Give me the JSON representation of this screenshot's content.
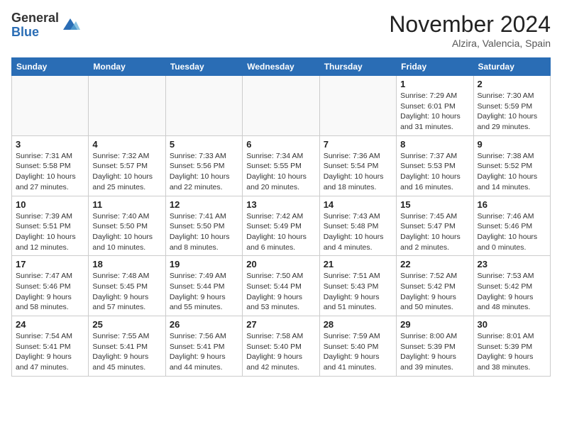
{
  "logo": {
    "general": "General",
    "blue": "Blue"
  },
  "header": {
    "month_year": "November 2024",
    "location": "Alzira, Valencia, Spain"
  },
  "weekdays": [
    "Sunday",
    "Monday",
    "Tuesday",
    "Wednesday",
    "Thursday",
    "Friday",
    "Saturday"
  ],
  "weeks": [
    [
      {
        "day": "",
        "info": ""
      },
      {
        "day": "",
        "info": ""
      },
      {
        "day": "",
        "info": ""
      },
      {
        "day": "",
        "info": ""
      },
      {
        "day": "",
        "info": ""
      },
      {
        "day": "1",
        "info": "Sunrise: 7:29 AM\nSunset: 6:01 PM\nDaylight: 10 hours\nand 31 minutes."
      },
      {
        "day": "2",
        "info": "Sunrise: 7:30 AM\nSunset: 5:59 PM\nDaylight: 10 hours\nand 29 minutes."
      }
    ],
    [
      {
        "day": "3",
        "info": "Sunrise: 7:31 AM\nSunset: 5:58 PM\nDaylight: 10 hours\nand 27 minutes."
      },
      {
        "day": "4",
        "info": "Sunrise: 7:32 AM\nSunset: 5:57 PM\nDaylight: 10 hours\nand 25 minutes."
      },
      {
        "day": "5",
        "info": "Sunrise: 7:33 AM\nSunset: 5:56 PM\nDaylight: 10 hours\nand 22 minutes."
      },
      {
        "day": "6",
        "info": "Sunrise: 7:34 AM\nSunset: 5:55 PM\nDaylight: 10 hours\nand 20 minutes."
      },
      {
        "day": "7",
        "info": "Sunrise: 7:36 AM\nSunset: 5:54 PM\nDaylight: 10 hours\nand 18 minutes."
      },
      {
        "day": "8",
        "info": "Sunrise: 7:37 AM\nSunset: 5:53 PM\nDaylight: 10 hours\nand 16 minutes."
      },
      {
        "day": "9",
        "info": "Sunrise: 7:38 AM\nSunset: 5:52 PM\nDaylight: 10 hours\nand 14 minutes."
      }
    ],
    [
      {
        "day": "10",
        "info": "Sunrise: 7:39 AM\nSunset: 5:51 PM\nDaylight: 10 hours\nand 12 minutes."
      },
      {
        "day": "11",
        "info": "Sunrise: 7:40 AM\nSunset: 5:50 PM\nDaylight: 10 hours\nand 10 minutes."
      },
      {
        "day": "12",
        "info": "Sunrise: 7:41 AM\nSunset: 5:50 PM\nDaylight: 10 hours\nand 8 minutes."
      },
      {
        "day": "13",
        "info": "Sunrise: 7:42 AM\nSunset: 5:49 PM\nDaylight: 10 hours\nand 6 minutes."
      },
      {
        "day": "14",
        "info": "Sunrise: 7:43 AM\nSunset: 5:48 PM\nDaylight: 10 hours\nand 4 minutes."
      },
      {
        "day": "15",
        "info": "Sunrise: 7:45 AM\nSunset: 5:47 PM\nDaylight: 10 hours\nand 2 minutes."
      },
      {
        "day": "16",
        "info": "Sunrise: 7:46 AM\nSunset: 5:46 PM\nDaylight: 10 hours\nand 0 minutes."
      }
    ],
    [
      {
        "day": "17",
        "info": "Sunrise: 7:47 AM\nSunset: 5:46 PM\nDaylight: 9 hours\nand 58 minutes."
      },
      {
        "day": "18",
        "info": "Sunrise: 7:48 AM\nSunset: 5:45 PM\nDaylight: 9 hours\nand 57 minutes."
      },
      {
        "day": "19",
        "info": "Sunrise: 7:49 AM\nSunset: 5:44 PM\nDaylight: 9 hours\nand 55 minutes."
      },
      {
        "day": "20",
        "info": "Sunrise: 7:50 AM\nSunset: 5:44 PM\nDaylight: 9 hours\nand 53 minutes."
      },
      {
        "day": "21",
        "info": "Sunrise: 7:51 AM\nSunset: 5:43 PM\nDaylight: 9 hours\nand 51 minutes."
      },
      {
        "day": "22",
        "info": "Sunrise: 7:52 AM\nSunset: 5:42 PM\nDaylight: 9 hours\nand 50 minutes."
      },
      {
        "day": "23",
        "info": "Sunrise: 7:53 AM\nSunset: 5:42 PM\nDaylight: 9 hours\nand 48 minutes."
      }
    ],
    [
      {
        "day": "24",
        "info": "Sunrise: 7:54 AM\nSunset: 5:41 PM\nDaylight: 9 hours\nand 47 minutes."
      },
      {
        "day": "25",
        "info": "Sunrise: 7:55 AM\nSunset: 5:41 PM\nDaylight: 9 hours\nand 45 minutes."
      },
      {
        "day": "26",
        "info": "Sunrise: 7:56 AM\nSunset: 5:41 PM\nDaylight: 9 hours\nand 44 minutes."
      },
      {
        "day": "27",
        "info": "Sunrise: 7:58 AM\nSunset: 5:40 PM\nDaylight: 9 hours\nand 42 minutes."
      },
      {
        "day": "28",
        "info": "Sunrise: 7:59 AM\nSunset: 5:40 PM\nDaylight: 9 hours\nand 41 minutes."
      },
      {
        "day": "29",
        "info": "Sunrise: 8:00 AM\nSunset: 5:39 PM\nDaylight: 9 hours\nand 39 minutes."
      },
      {
        "day": "30",
        "info": "Sunrise: 8:01 AM\nSunset: 5:39 PM\nDaylight: 9 hours\nand 38 minutes."
      }
    ]
  ]
}
